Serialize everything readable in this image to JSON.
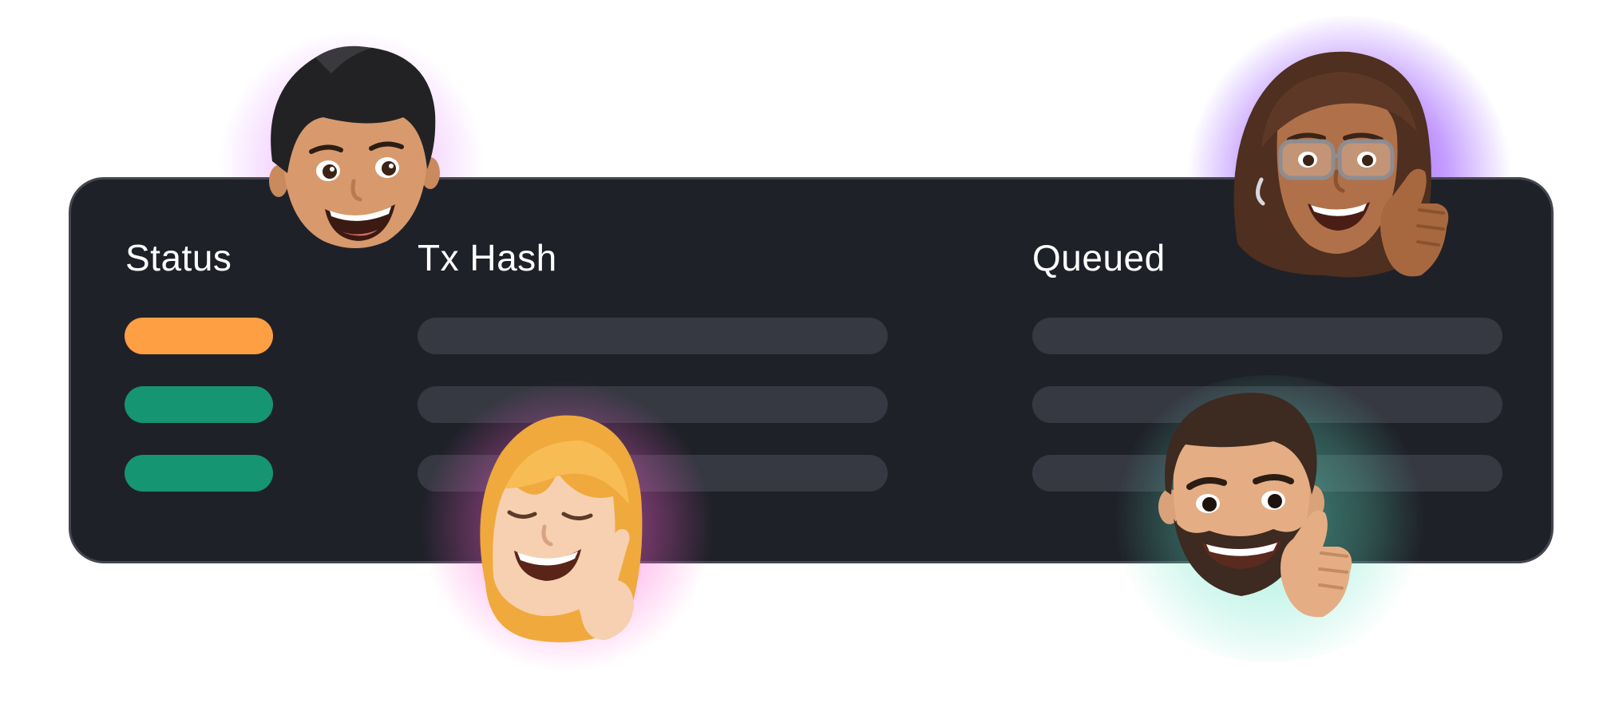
{
  "table": {
    "headers": {
      "status": "Status",
      "tx_hash": "Tx Hash",
      "queued": "Queued"
    },
    "rows": [
      {
        "status_color": "#ff9f43"
      },
      {
        "status_color": "#159572"
      },
      {
        "status_color": "#159572"
      }
    ],
    "placeholder_color": "#363842"
  },
  "avatars": [
    {
      "icon": "memoji-man-short-hair-icon",
      "glow": "#e7a8ff"
    },
    {
      "icon": "memoji-woman-glasses-thumbs-up-icon",
      "glow": "#8b3dff"
    },
    {
      "icon": "memoji-woman-blonde-peace-sign-icon",
      "glow": "#ff5fd2"
    },
    {
      "icon": "memoji-man-beard-thumbs-up-icon",
      "glow": "#5fe3c2"
    }
  ]
}
